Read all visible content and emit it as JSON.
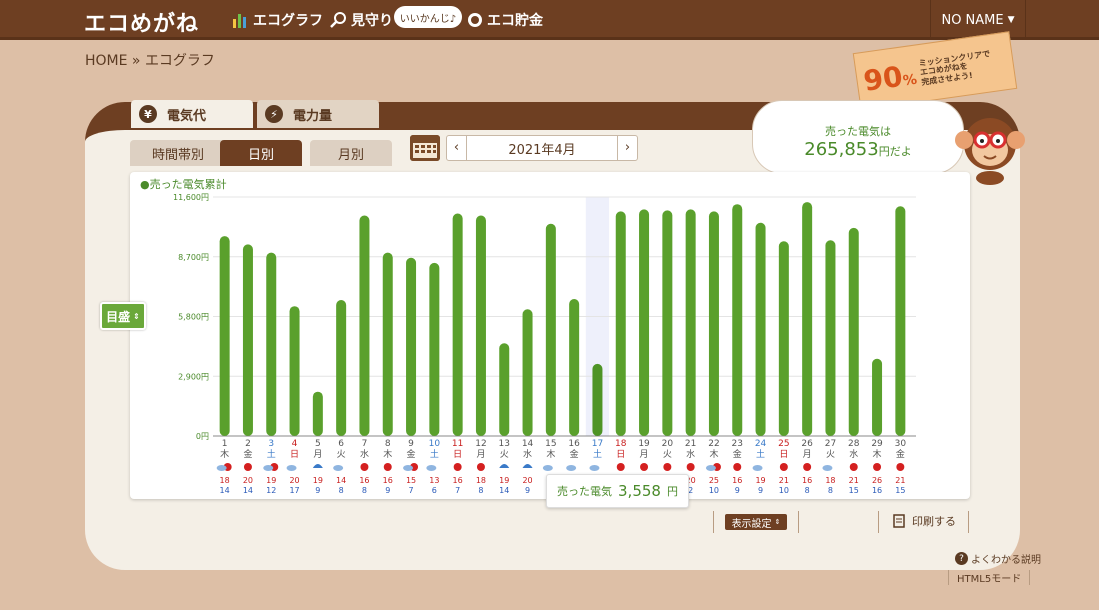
{
  "header": {
    "logo": "エコめがね",
    "nav": [
      {
        "label": "エコグラフ",
        "icon": "graph-icon"
      },
      {
        "label": "見守り",
        "icon": "magnifier-icon"
      },
      {
        "label": "エコ貯金",
        "icon": "coin-icon"
      }
    ],
    "badge": "いいかんじ♪",
    "user": "NO NAME"
  },
  "breadcrumb": "HOME » エコグラフ",
  "mission": {
    "percent": "90",
    "unit": "%",
    "text_l1": "ミッションクリアで",
    "text_l2": "エコめがねを",
    "text_l3": "完成させよう!"
  },
  "tabs": {
    "elec_cost": "電気代",
    "power": "電力量"
  },
  "subtabs": {
    "hour": "時間帯別",
    "day": "日別",
    "month": "月別"
  },
  "month_label": "2021年4月",
  "bubble": {
    "line1": "売った電気は",
    "amount": "265,853",
    "unit": "円だよ"
  },
  "memori": "目盛",
  "legend": "●売った電気累計",
  "tooltip": {
    "label": "売った電気",
    "value": "3,558",
    "unit": "円"
  },
  "display_settings": "表示設定",
  "print": "印刷する",
  "help": "よくわかる説明",
  "html5": "HTML5モード",
  "colors": {
    "bar": "#5aa02c",
    "bar_highlight": "#4e9426",
    "sat": "#3a7ac8",
    "sun": "#c81e1e",
    "highlight_col": "#eef0fb"
  },
  "chart_data": {
    "type": "bar",
    "title": "",
    "legend": "売った電気累計",
    "ylabel": "",
    "ylim": [
      0,
      11600
    ],
    "yticks": [
      "0円",
      "2,900円",
      "5,800円",
      "8,700円",
      "11,600円"
    ],
    "ytick_values": [
      0,
      2900,
      5800,
      8700,
      11600
    ],
    "days": [
      "1",
      "2",
      "3",
      "4",
      "5",
      "6",
      "7",
      "8",
      "9",
      "10",
      "11",
      "12",
      "13",
      "14",
      "15",
      "16",
      "17",
      "18",
      "19",
      "20",
      "21",
      "22",
      "23",
      "24",
      "25",
      "26",
      "27",
      "28",
      "29",
      "30"
    ],
    "weekdays": [
      "木",
      "金",
      "土",
      "日",
      "月",
      "火",
      "水",
      "木",
      "金",
      "土",
      "日",
      "月",
      "火",
      "水",
      "木",
      "金",
      "土",
      "日",
      "月",
      "火",
      "水",
      "木",
      "金",
      "土",
      "日",
      "月",
      "火",
      "水",
      "木",
      "金"
    ],
    "values": [
      9700,
      9300,
      8900,
      6300,
      2150,
      6600,
      10700,
      8900,
      8650,
      8400,
      10800,
      10700,
      4500,
      6150,
      10300,
      6650,
      3500,
      10900,
      11000,
      10950,
      11000,
      10900,
      11250,
      10350,
      9450,
      11350,
      9500,
      10100,
      3750,
      11150
    ],
    "highlight_day": "17",
    "temp_high": [
      "18",
      "20",
      "19",
      "20",
      "19",
      "14",
      "16",
      "16",
      "15",
      "13",
      "16",
      "18",
      "19",
      "20",
      "",
      "",
      "",
      "",
      "",
      "",
      "20",
      "25",
      "16",
      "19",
      "21",
      "16",
      "18",
      "21",
      "26",
      "21"
    ],
    "temp_low": [
      "14",
      "14",
      "12",
      "17",
      "9",
      "8",
      "8",
      "9",
      "7",
      "6",
      "7",
      "8",
      "14",
      "9",
      "",
      "",
      "",
      "",
      "",
      "",
      "2",
      "10",
      "9",
      "9",
      "10",
      "8",
      "8",
      "15",
      "16",
      "15"
    ],
    "weather": [
      "sun-cloud",
      "sun",
      "sun-cloud",
      "cloud",
      "umbrella",
      "cloud",
      "sun",
      "sun",
      "sun-cloud",
      "cloud",
      "sun",
      "sun",
      "umbrella",
      "umbrella",
      "cloud",
      "cloud",
      "cloud",
      "sun",
      "sun",
      "sun",
      "sun",
      "sun-cloud",
      "sun",
      "cloud",
      "sun",
      "sun",
      "cloud",
      "sun",
      "sun",
      "sun"
    ]
  }
}
